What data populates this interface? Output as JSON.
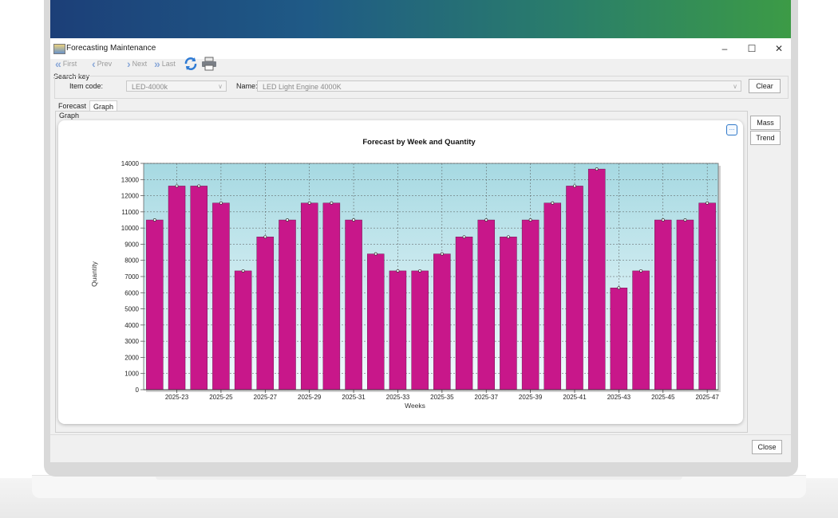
{
  "window": {
    "title": "Forecasting Maintenance",
    "minimize": "–",
    "maximize": "☐",
    "close": "✕"
  },
  "toolbar": {
    "first": "First",
    "prev": "Prev",
    "next": "Next",
    "last": "Last"
  },
  "search": {
    "group_label": "Search key",
    "item_code_label": "Item code:",
    "item_code_value": "LED-4000k",
    "name_label": "Name:",
    "name_value": "LED Light Engine 4000K",
    "clear_label": "Clear"
  },
  "tabs": [
    {
      "label": "Forecast",
      "active": false
    },
    {
      "label": "Graph",
      "active": true
    }
  ],
  "graph_group_label": "Graph",
  "side_buttons": {
    "mass": "Mass",
    "trend": "Trend",
    "ellipsis": "..."
  },
  "footer": {
    "close_label": "Close"
  },
  "colors": {
    "bar": "#c8178a",
    "plot_top": "#a6d9e2",
    "plot_bottom": "#f2fbfd"
  },
  "chart_data": {
    "type": "bar",
    "title": "Forecast by Week and Quantity",
    "xlabel": "Weeks",
    "ylabel": "Quantity",
    "ylim": [
      0,
      14000
    ],
    "yticks": [
      0,
      1000,
      2000,
      3000,
      4000,
      5000,
      6000,
      7000,
      8000,
      9000,
      10000,
      11000,
      12000,
      13000,
      14000
    ],
    "xtick_labels": [
      "2025-23",
      "2025-25",
      "2025-27",
      "2025-29",
      "2025-31",
      "2025-33",
      "2025-35",
      "2025-37",
      "2025-39",
      "2025-41",
      "2025-43",
      "2025-45",
      "2025-47"
    ],
    "categories": [
      "2025-22",
      "2025-23",
      "2025-24",
      "2025-25",
      "2025-26",
      "2025-27",
      "2025-28",
      "2025-29",
      "2025-30",
      "2025-31",
      "2025-32",
      "2025-33",
      "2025-34",
      "2025-35",
      "2025-36",
      "2025-37",
      "2025-38",
      "2025-39",
      "2025-40",
      "2025-41",
      "2025-42",
      "2025-43",
      "2025-44",
      "2025-45",
      "2025-46",
      "2025-47"
    ],
    "values": [
      10500,
      12600,
      12600,
      11550,
      7350,
      9450,
      10500,
      11550,
      11550,
      10500,
      8400,
      7350,
      7350,
      8400,
      9450,
      10500,
      9450,
      10500,
      11550,
      12600,
      13650,
      6300,
      7350,
      10500,
      10500,
      11550
    ],
    "grid": true
  }
}
